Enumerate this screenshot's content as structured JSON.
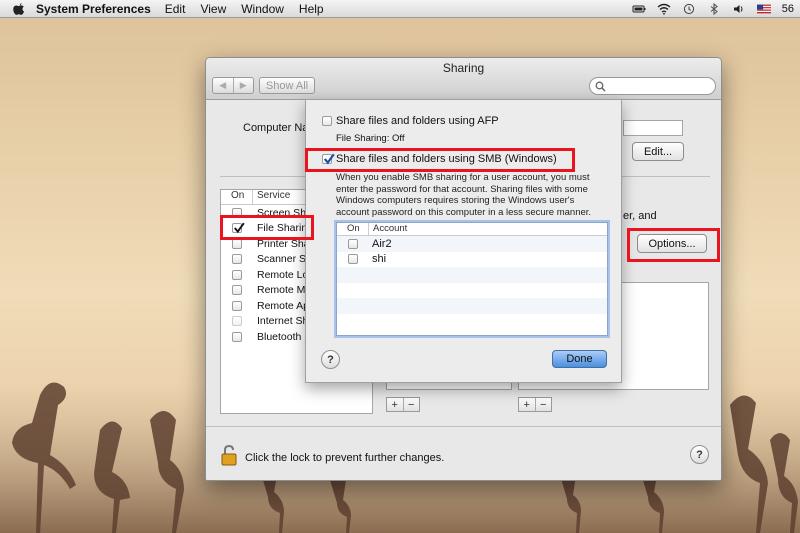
{
  "menubar": {
    "app_name": "System Preferences",
    "menus": [
      "Edit",
      "View",
      "Window",
      "Help"
    ],
    "clock_partial": "56"
  },
  "window": {
    "title": "Sharing",
    "show_all_label": "Show All",
    "search_placeholder": "",
    "computer_name_label": "Computer Na",
    "edit_button": "Edit...",
    "services_header": {
      "on": "On",
      "service": "Service"
    },
    "services": [
      {
        "label": "Screen Sha",
        "checked": false
      },
      {
        "label": "File Sharing",
        "checked": true
      },
      {
        "label": "Printer Sha",
        "checked": false
      },
      {
        "label": "Scanner Sh",
        "checked": false
      },
      {
        "label": "Remote Lo",
        "checked": false
      },
      {
        "label": "Remote Ma",
        "checked": false
      },
      {
        "label": "Remote Ap",
        "checked": false
      },
      {
        "label": "Internet Sh",
        "checked": false
      },
      {
        "label": "Bluetooth S",
        "checked": false
      }
    ],
    "right_fragment": "er, and",
    "options_button": "Options...",
    "add_symbol": "+",
    "remove_symbol": "−",
    "lock_text": "Click the lock to prevent further changes.",
    "help_symbol": "?"
  },
  "sheet": {
    "afp_label": "Share files and folders using AFP",
    "afp_checked": false,
    "afp_status": "File Sharing: Off",
    "smb_label": "Share files and folders using SMB (Windows)",
    "smb_checked": true,
    "smb_description": "When you enable SMB sharing for a user account, you must enter the password for that account. Sharing files with some Windows computers requires storing the Windows user's account password on this computer in a less secure manner.",
    "accounts_header": {
      "on": "On",
      "account": "Account"
    },
    "accounts": [
      {
        "name": "Air2",
        "checked": false
      },
      {
        "name": "shi",
        "checked": false
      }
    ],
    "help_symbol": "?",
    "done_button": "Done"
  },
  "colors": {
    "highlight": "#e8141e",
    "selection": "#a9c3e8",
    "done_button": "#4b8fe0"
  }
}
